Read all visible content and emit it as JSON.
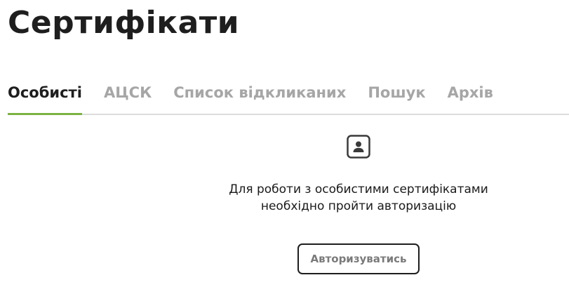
{
  "page": {
    "title": "Сертифікати"
  },
  "tabs": [
    {
      "label": "Особисті",
      "active": true
    },
    {
      "label": "АЦСК",
      "active": false
    },
    {
      "label": "Список відкликаних",
      "active": false
    },
    {
      "label": "Пошук",
      "active": false
    },
    {
      "label": "Архів",
      "active": false
    }
  ],
  "empty_state": {
    "icon": "user-icon",
    "message_line1": "Для роботи з особистими сертифікатами",
    "message_line2": "необхідно пройти авторизацію",
    "button_label": "Авторизуватись"
  },
  "colors": {
    "active_tab_underline": "#7cb342",
    "inactive_tab_text": "#a6a6a6",
    "title_text": "#1e1e1e"
  }
}
